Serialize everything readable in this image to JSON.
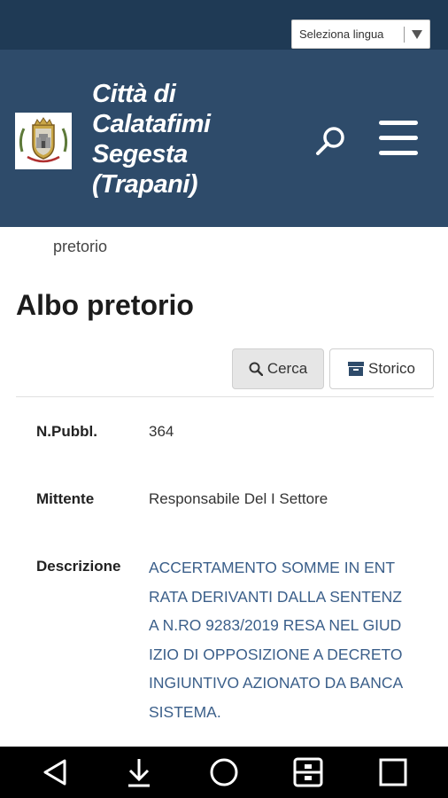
{
  "language_selector": {
    "label": "Seleziona lingua"
  },
  "header": {
    "title_lines": [
      "Città di",
      "Calatafimi",
      "Segesta",
      "(Trapani)"
    ]
  },
  "breadcrumb": {
    "current": "pretorio"
  },
  "page": {
    "title": "Albo pretorio",
    "buttons": {
      "search": "Cerca",
      "history": "Storico"
    }
  },
  "record": {
    "fields": [
      {
        "label": "N.Pubbl.",
        "value": "364"
      },
      {
        "label": "Mittente",
        "value": "Responsabile Del I Settore"
      },
      {
        "label": "Descrizione",
        "value": "ACCERTAMENTO SOMME IN ENTRATA DERIVANTI DALLA SENTENZA N.RO 9283/2019 RESA NEL GIUDIZIO DI OPPOSIZIONE A DECRETO INGIUNTIVO AZIONATO DA BANCA SISTEMA."
      }
    ]
  },
  "colors": {
    "topbar": "#1f3a55",
    "header": "#2e4b6a",
    "link": "#3b5f8a"
  },
  "icons": {
    "search": "search-icon",
    "menu": "hamburger-menu-icon",
    "archive": "archive-icon",
    "nav": [
      "back-icon",
      "download-icon",
      "home-icon",
      "multitask-icon",
      "recent-apps-icon"
    ]
  }
}
